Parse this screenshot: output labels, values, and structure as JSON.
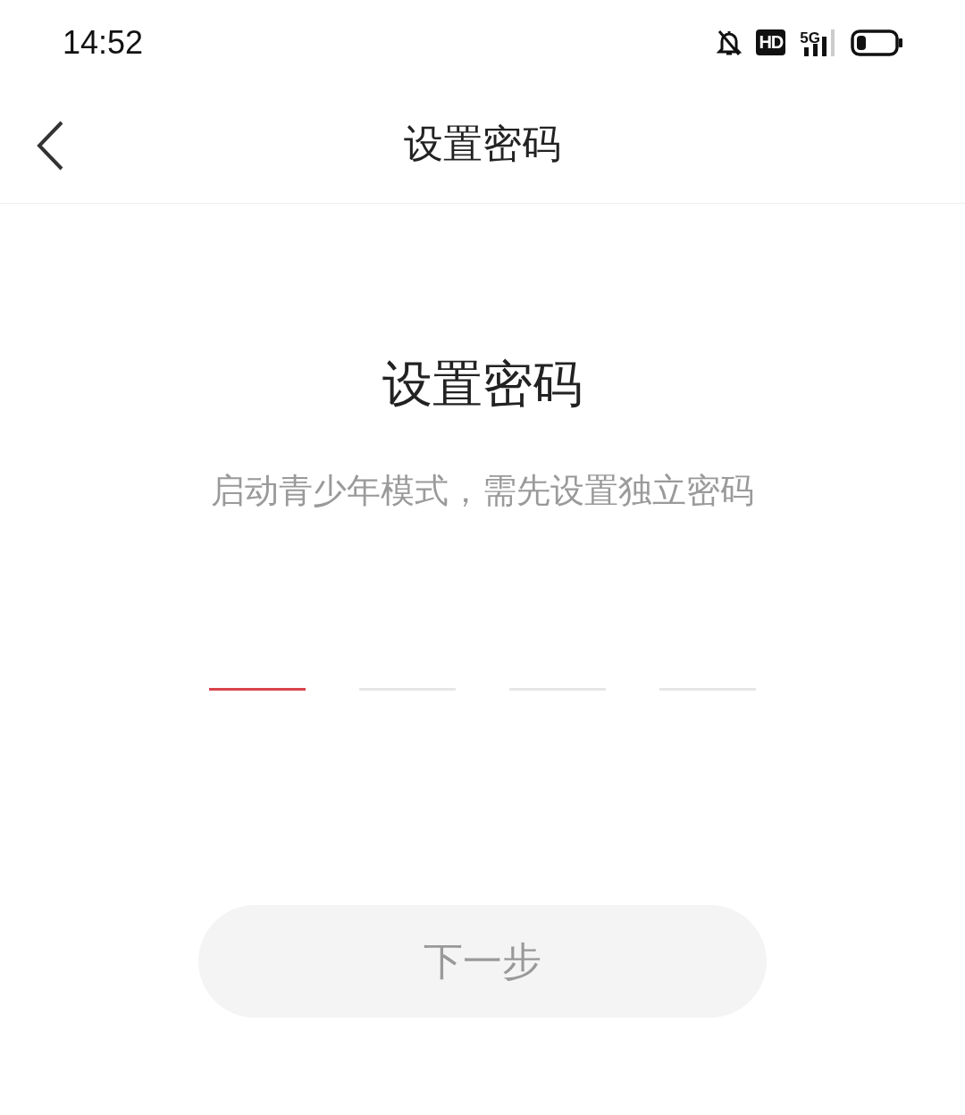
{
  "status_bar": {
    "time": "14:52",
    "hd_label": "HD",
    "network_label": "5G"
  },
  "header": {
    "title": "设置密码"
  },
  "heading": "设置密码",
  "subtitle": "启动青少年模式，需先设置独立密码",
  "code_slots": [
    {
      "selected": true
    },
    {
      "selected": false
    },
    {
      "selected": false
    },
    {
      "selected": false
    }
  ],
  "next_button": {
    "label": "下一步",
    "disabled": true
  }
}
